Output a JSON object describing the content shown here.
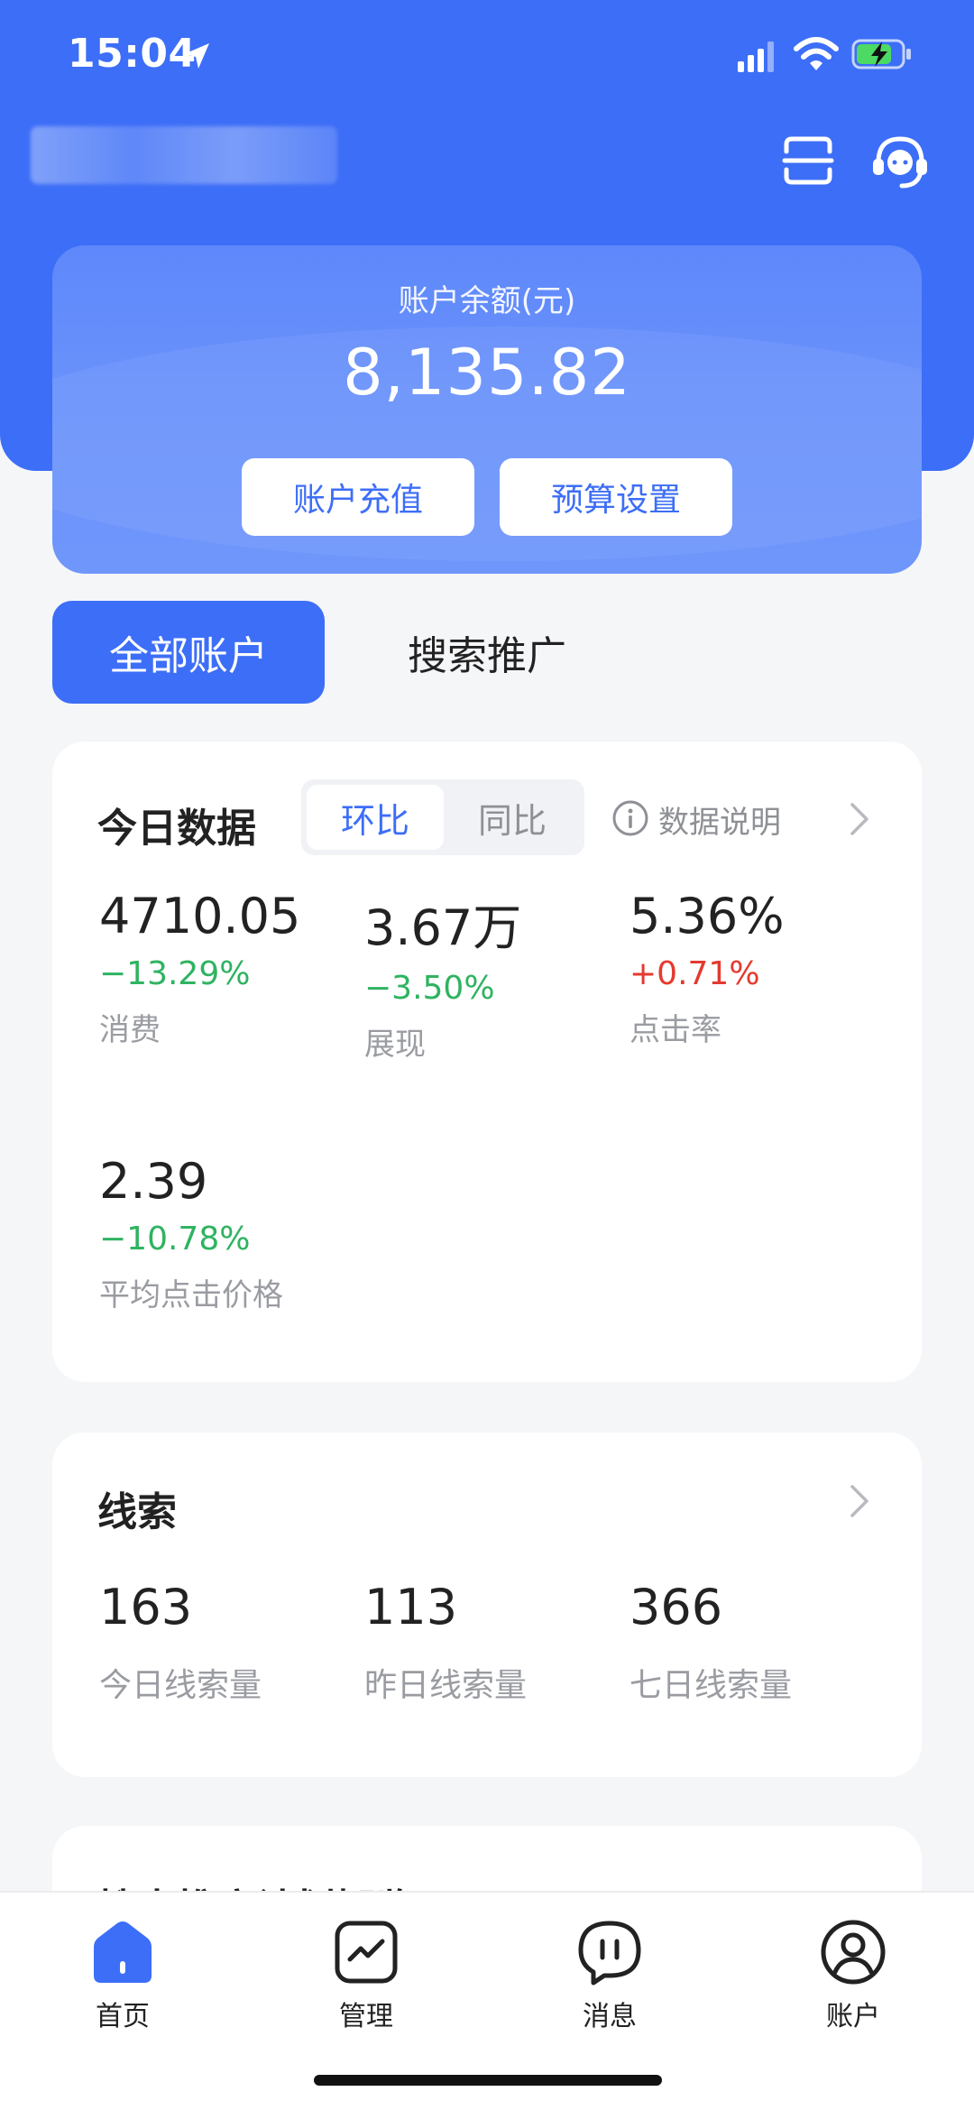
{
  "status_bar": {
    "time": "15:04"
  },
  "balance": {
    "label": "账户余额(元)",
    "value": "8,135.82",
    "recharge_label": "账户充值",
    "budget_label": "预算设置"
  },
  "tabs": [
    {
      "label": "全部账户",
      "active": true
    },
    {
      "label": "搜索推广",
      "active": false
    }
  ],
  "today": {
    "title": "今日数据",
    "segments": [
      "环比",
      "同比"
    ],
    "note": "数据说明",
    "metrics": [
      {
        "value": "4710.05",
        "change": "−13.29%",
        "label": "消费"
      },
      {
        "value": "3.67万",
        "change": "−3.50%",
        "label": "展现"
      },
      {
        "value": "5.36%",
        "change": "+0.71%",
        "label": "点击率"
      },
      {
        "value": "2.39",
        "change": "−10.78%",
        "label": "平均点击价格"
      }
    ]
  },
  "leads": {
    "title": "线索",
    "items": [
      {
        "value": "163",
        "label": "今日线索量"
      },
      {
        "value": "113",
        "label": "昨日线索量"
      },
      {
        "value": "366",
        "label": "七日线索量"
      }
    ]
  },
  "plan": {
    "title": "搜索推广计划概览"
  },
  "nav": {
    "home": "首页",
    "manage": "管理",
    "messages": "消息",
    "account": "账户"
  },
  "colors": {
    "primary": "#3d6ef7",
    "down": "#2fb361",
    "up": "#e43a2f",
    "muted": "#9a9ca2"
  }
}
